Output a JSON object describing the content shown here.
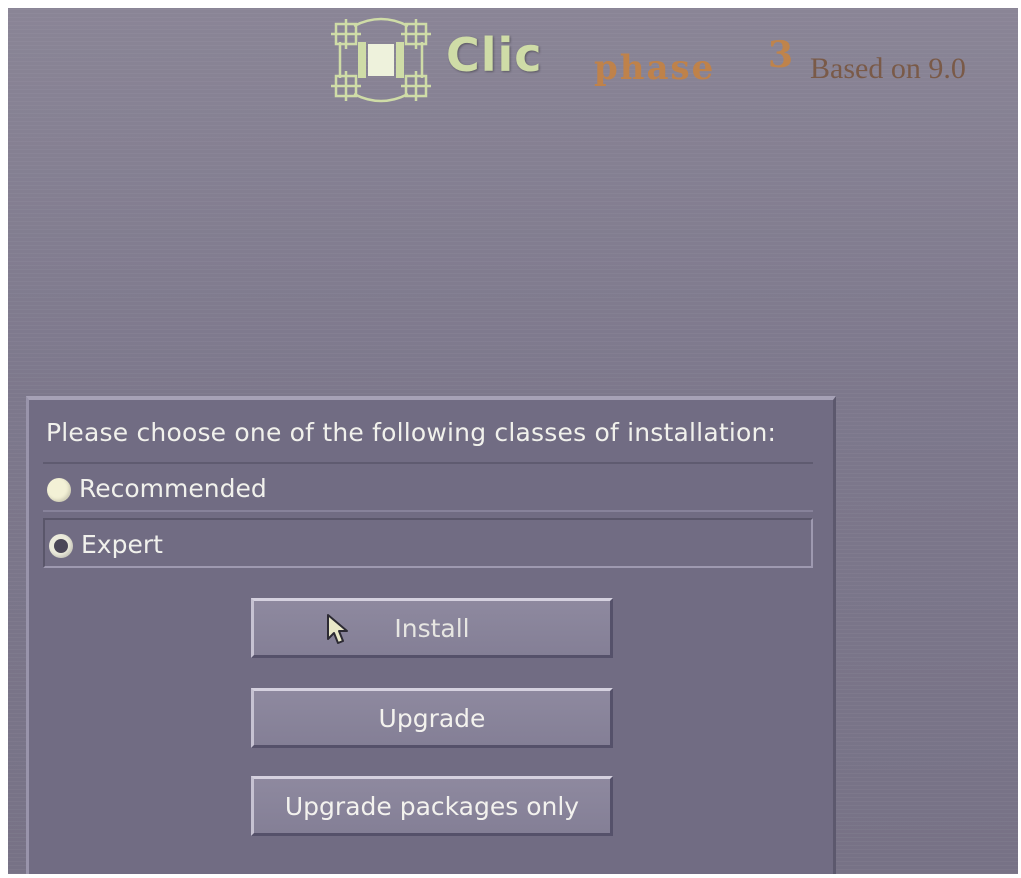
{
  "header": {
    "logo_text": "Clic",
    "phase_text": "phase",
    "phase_number": "3",
    "based_on": "Based on 9.0"
  },
  "dialog": {
    "prompt": "Please choose one of the following classes of installation:",
    "options": [
      {
        "label": "Recommended",
        "selected": false
      },
      {
        "label": "Expert",
        "selected": true
      }
    ],
    "buttons": {
      "install": "Install",
      "upgrade": "Upgrade",
      "upgrade_packages": "Upgrade packages only"
    }
  },
  "colors": {
    "background": "#7f7a8e",
    "dialog": "#716c83",
    "logo": "#cfdca7",
    "phase": "#c9823e",
    "text": "#f1f1ec"
  }
}
